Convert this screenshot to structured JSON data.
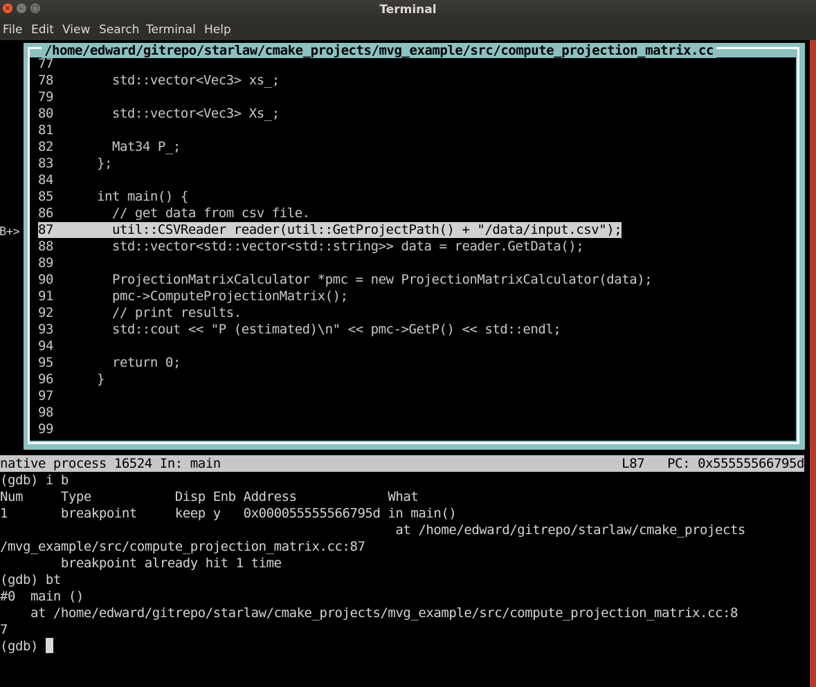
{
  "window": {
    "title": "Terminal"
  },
  "menu": [
    "File",
    "Edit",
    "View",
    "Search",
    "Terminal",
    "Help"
  ],
  "source": {
    "path": "/home/edward/gitrepo/starlaw/cmake_projects/mvg_example/src/compute_projection_matrix.cc",
    "breakpoint_marker": "B+>",
    "current_line": 87,
    "lines": [
      {
        "n": "77",
        "code": ""
      },
      {
        "n": "78",
        "code": "    std::vector<Vec3> xs_;"
      },
      {
        "n": "79",
        "code": ""
      },
      {
        "n": "80",
        "code": "    std::vector<Vec3> Xs_;"
      },
      {
        "n": "81",
        "code": ""
      },
      {
        "n": "82",
        "code": "    Mat34 P_;"
      },
      {
        "n": "83",
        "code": "  };"
      },
      {
        "n": "84",
        "code": ""
      },
      {
        "n": "85",
        "code": "  int main() {"
      },
      {
        "n": "86",
        "code": "    // get data from csv file."
      },
      {
        "n": "87",
        "code": "    util::CSVReader reader(util::GetProjectPath() + \"/data/input.csv\");"
      },
      {
        "n": "88",
        "code": "    std::vector<std::vector<std::string>> data = reader.GetData();"
      },
      {
        "n": "89",
        "code": ""
      },
      {
        "n": "90",
        "code": "    ProjectionMatrixCalculator *pmc = new ProjectionMatrixCalculator(data);"
      },
      {
        "n": "91",
        "code": "    pmc->ComputeProjectionMatrix();"
      },
      {
        "n": "92",
        "code": "    // print results."
      },
      {
        "n": "93",
        "code": "    std::cout << \"P (estimated)\\n\" << pmc->GetP() << std::endl;"
      },
      {
        "n": "94",
        "code": ""
      },
      {
        "n": "95",
        "code": "    return 0;"
      },
      {
        "n": "96",
        "code": "  }"
      },
      {
        "n": "97",
        "code": ""
      },
      {
        "n": "98",
        "code": ""
      },
      {
        "n": "99",
        "code": ""
      }
    ]
  },
  "status": {
    "left": "native process 16524 In: main",
    "right": "L87   PC: 0x55555566795d"
  },
  "gdb": [
    "(gdb) i b",
    "Num     Type           Disp Enb Address            What",
    "1       breakpoint     keep y   0x000055555566795d in main()",
    "                                                    at /home/edward/gitrepo/starlaw/cmake_projects",
    "/mvg_example/src/compute_projection_matrix.cc:87",
    "        breakpoint already hit 1 time",
    "(gdb) bt",
    "#0  main ()",
    "    at /home/edward/gitrepo/starlaw/cmake_projects/mvg_example/src/compute_projection_matrix.cc:8",
    "7",
    "(gdb) "
  ]
}
